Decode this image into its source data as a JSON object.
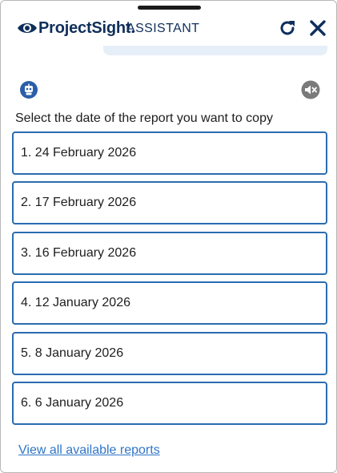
{
  "header": {
    "brand": "ProjectSight.",
    "subtitle": "ASSISTANT",
    "icons": {
      "logo": "eye-logo-icon",
      "refresh": "refresh-icon",
      "close": "close-icon"
    }
  },
  "chat": {
    "bot_icon": "robot-icon",
    "mute_icon": "speaker-muted-icon",
    "prompt": "Select the date of the report you want to copy",
    "options": [
      "1. 24 February 2026",
      "2. 17 February 2026",
      "3. 16 February 2026",
      "4. 12 January 2026",
      "5. 8 January 2026",
      "6. 6 January 2026"
    ],
    "view_all_link": "View all available reports"
  },
  "colors": {
    "brand": "#0f2f5b",
    "option_border": "#2b6cb0",
    "link": "#2f76c7",
    "bubble": "#e6eef8"
  }
}
